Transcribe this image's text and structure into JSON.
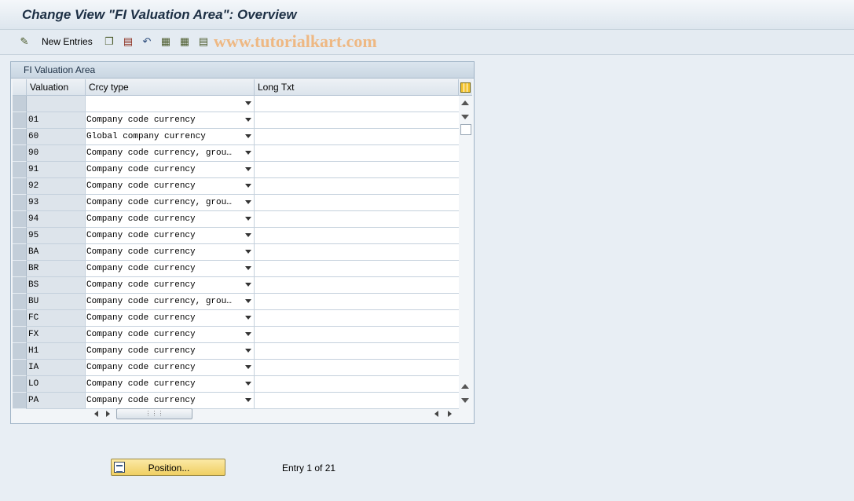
{
  "window": {
    "title": "Change View \"FI Valuation Area\": Overview"
  },
  "toolbar": {
    "new_entries_label": "New Entries",
    "watermark": "www.tutorialkart.com",
    "icons": [
      "display-change-icon",
      "copy-icon",
      "delete-icon",
      "undo-icon",
      "select-all-icon",
      "select-block-icon",
      "deselect-all-icon"
    ]
  },
  "panel": {
    "title": "FI Valuation Area"
  },
  "table": {
    "columns": [
      "Valuation",
      "Crcy type",
      "Long Txt"
    ],
    "rows": [
      {
        "valuation": "",
        "crcy_type": "",
        "long_txt": ""
      },
      {
        "valuation": "01",
        "crcy_type": "Company code currency",
        "long_txt": ""
      },
      {
        "valuation": "60",
        "crcy_type": "Global company currency",
        "long_txt": ""
      },
      {
        "valuation": "90",
        "crcy_type": "Company code currency, grou…",
        "long_txt": ""
      },
      {
        "valuation": "91",
        "crcy_type": "Company code currency",
        "long_txt": ""
      },
      {
        "valuation": "92",
        "crcy_type": "Company code currency",
        "long_txt": ""
      },
      {
        "valuation": "93",
        "crcy_type": "Company code currency, grou…",
        "long_txt": ""
      },
      {
        "valuation": "94",
        "crcy_type": "Company code currency",
        "long_txt": ""
      },
      {
        "valuation": "95",
        "crcy_type": "Company code currency",
        "long_txt": ""
      },
      {
        "valuation": "BA",
        "crcy_type": "Company code currency",
        "long_txt": ""
      },
      {
        "valuation": "BR",
        "crcy_type": "Company code currency",
        "long_txt": ""
      },
      {
        "valuation": "BS",
        "crcy_type": "Company code currency",
        "long_txt": ""
      },
      {
        "valuation": "BU",
        "crcy_type": "Company code currency, grou…",
        "long_txt": ""
      },
      {
        "valuation": "FC",
        "crcy_type": "Company code currency",
        "long_txt": ""
      },
      {
        "valuation": "FX",
        "crcy_type": "Company code currency",
        "long_txt": ""
      },
      {
        "valuation": "H1",
        "crcy_type": "Company code currency",
        "long_txt": ""
      },
      {
        "valuation": "IA",
        "crcy_type": "Company code currency",
        "long_txt": ""
      },
      {
        "valuation": "LO",
        "crcy_type": "Company code currency",
        "long_txt": ""
      },
      {
        "valuation": "PA",
        "crcy_type": "Company code currency",
        "long_txt": ""
      }
    ]
  },
  "footer": {
    "position_label": "Position...",
    "entry_text": "Entry 1 of 21"
  }
}
